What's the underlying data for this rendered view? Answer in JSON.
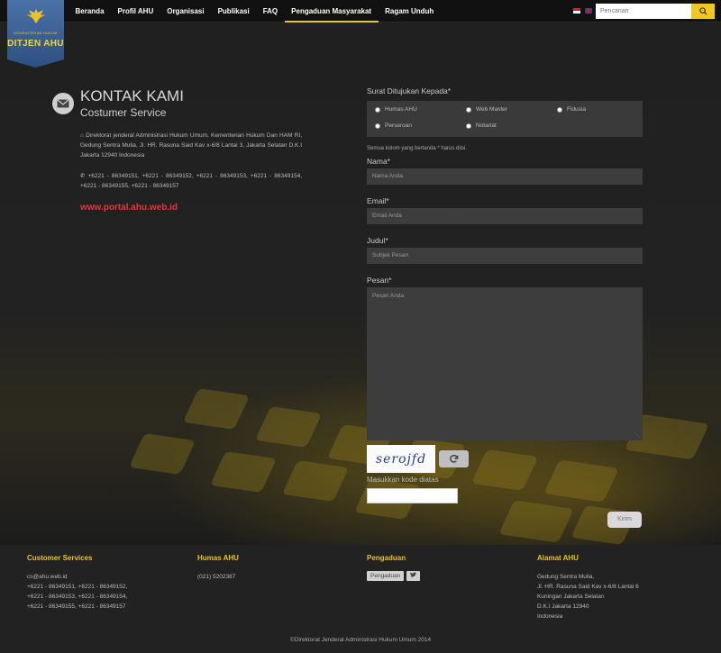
{
  "brand": {
    "logo_text": "DITJEN AHU",
    "logo_subtext": "KEMENTERIAN HUKUM"
  },
  "nav": {
    "items": [
      {
        "label": "Beranda"
      },
      {
        "label": "Profil AHU"
      },
      {
        "label": "Organisasi"
      },
      {
        "label": "Publikasi"
      },
      {
        "label": "FAQ"
      },
      {
        "label": "Pengaduan Masyarakat",
        "active": true
      },
      {
        "label": "Ragam Unduh"
      }
    ]
  },
  "search": {
    "placeholder": "Pencarian"
  },
  "contact": {
    "title": "KONTAK KAMI",
    "subtitle": "Costumer Service",
    "address": "Direktorat jenderal Administrasi Hukum Umum, Kementerian Hukum Dan HAM RI, Gedung Sentra Mulia, Jl. HR. Rasuna Said Kav x-6/8 Lantai 3, Jakarta Selatan D.K.I Jakarta 12940 Indonesia",
    "phones": "+6221 - 86349151, +6221 - 86349152, +6221 - 86349153, +6221 - 86349154, +6221 - 86349155, +6221 - 86349157",
    "portal": "www.portal.ahu.web.id"
  },
  "form": {
    "recipient_label": "Surat Ditujukan Kepada*",
    "recipients": [
      "Humas AHU",
      "Web Master",
      "Fidusia",
      "Perseroan",
      "Notariat"
    ],
    "required_note": "Semua kolom yang bertanda * harus diisi.",
    "name_label": "Nama*",
    "name_placeholder": "Nama Anda",
    "email_label": "Email*",
    "email_placeholder": "Email Anda",
    "subject_label": "Judul*",
    "subject_placeholder": "Subjek Pesan",
    "message_label": "Pesan*",
    "message_placeholder": "Pesan Anda",
    "captcha_text": "serojfd",
    "captcha_label": "Masukkan kode diatas",
    "submit_label": "Kirim"
  },
  "footer": {
    "cs_title": "Customer Services",
    "cs_email": "cs@ahu.web.id",
    "cs_phone1": "+6221 - 86349151, +6221 - 86349152,",
    "cs_phone2": "+6221 - 86349153, +6221 - 86349154,",
    "cs_phone3": "+6221 - 86349155, +6221 - 86349157",
    "humas_title": "Humas AHU",
    "humas_phone": "(021) 5202387",
    "pengaduan_title": "Pengaduan",
    "pengaduan_button": "Pengaduan",
    "alamat_title": "Alamat AHU",
    "alamat_1": "Gedung Sentra Mulia,",
    "alamat_2": "Jl. HR. Rasuna Said Kav x-6/8 Lantai 6",
    "alamat_3": "Kuningan Jakarta Selatan",
    "alamat_4": "D.K.I Jakarta 12940",
    "alamat_5": "Indonesia",
    "copyright": "©Direktorat Jenderal Administrasi Hukum Umum 2014"
  },
  "colors": {
    "accent": "#e8c22a",
    "link_red": "#e0393e",
    "logo_blue": "#3a5f94"
  }
}
